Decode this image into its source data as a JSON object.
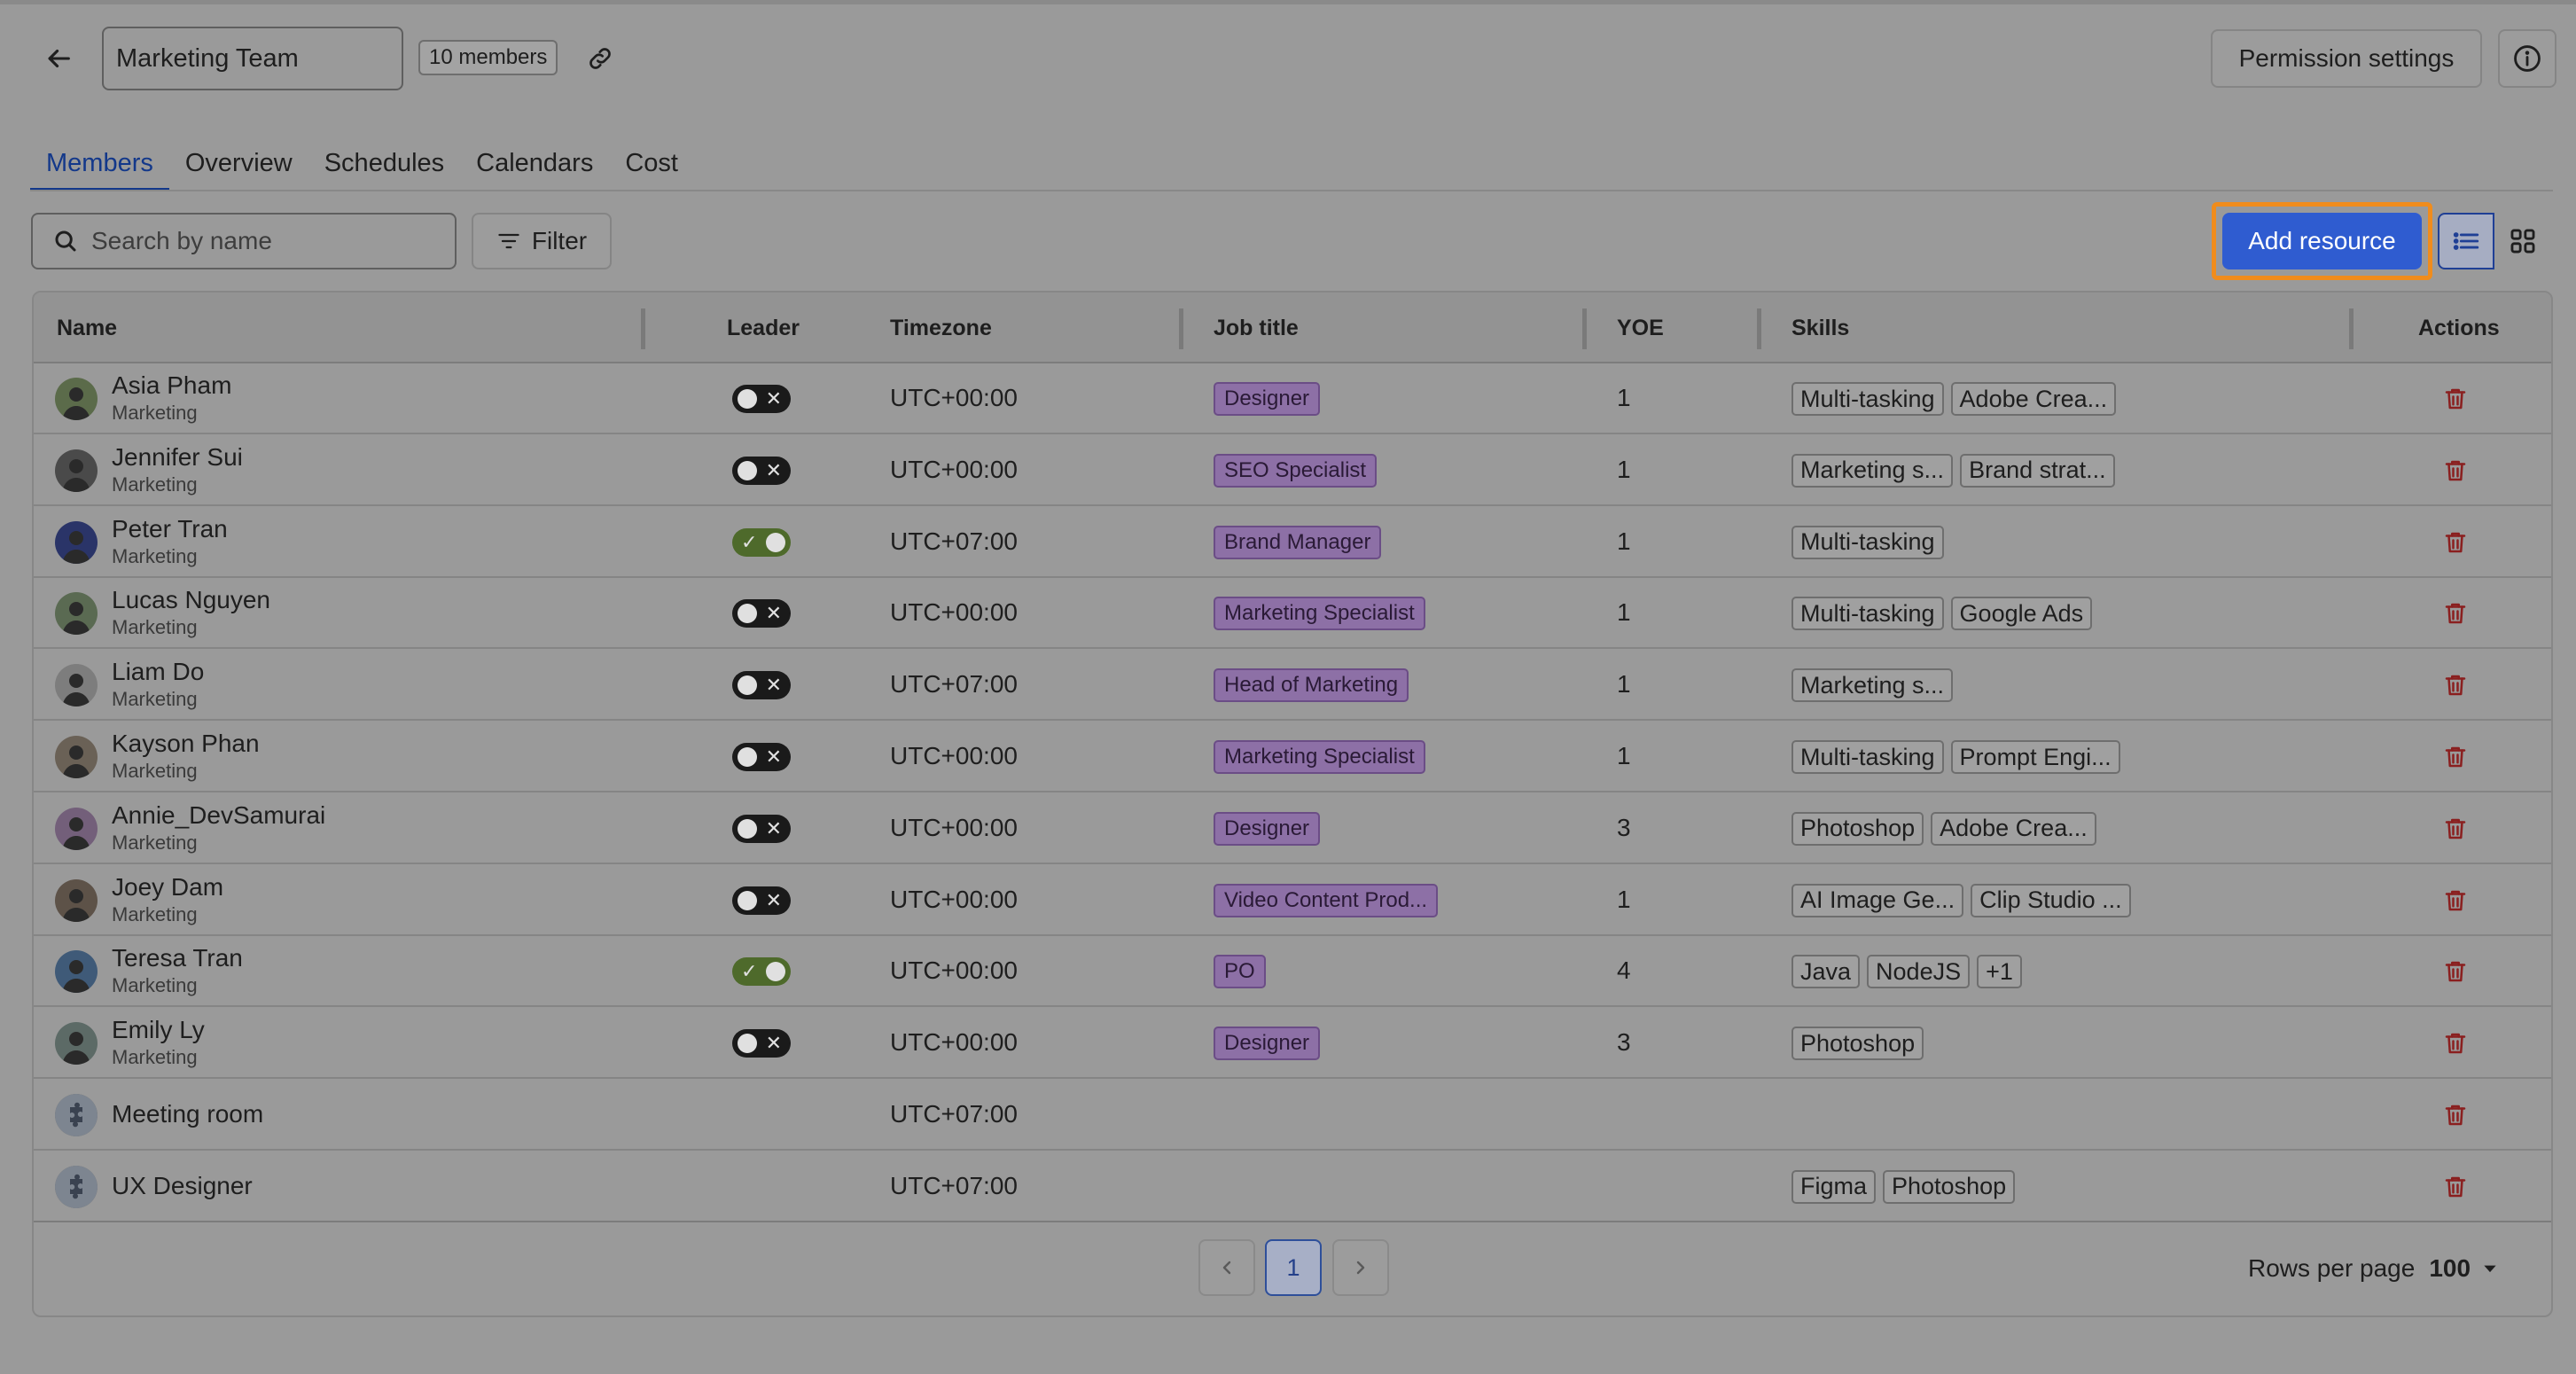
{
  "header": {
    "team_name": "Marketing Team",
    "members_badge": "10 members",
    "permission_label": "Permission settings"
  },
  "tabs": [
    {
      "label": "Members",
      "active": true
    },
    {
      "label": "Overview"
    },
    {
      "label": "Schedules"
    },
    {
      "label": "Calendars"
    },
    {
      "label": "Cost"
    }
  ],
  "toolbar": {
    "search_placeholder": "Search by name",
    "filter_label": "Filter",
    "add_label": "Add resource",
    "view_mode": "list"
  },
  "table": {
    "columns": {
      "name": "Name",
      "leader": "Leader",
      "timezone": "Timezone",
      "job_title": "Job title",
      "yoe": "YOE",
      "skills": "Skills",
      "actions": "Actions"
    },
    "rows": [
      {
        "name": "Asia Pham",
        "team": "Marketing",
        "leader": false,
        "timezone": "UTC+00:00",
        "job": "Designer",
        "yoe": "1",
        "skills": [
          "Multi-tasking",
          "Adobe Crea..."
        ],
        "avatar": "#5b6b4a"
      },
      {
        "name": "Jennifer Sui",
        "team": "Marketing",
        "leader": false,
        "timezone": "UTC+00:00",
        "job": "SEO Specialist",
        "yoe": "1",
        "skills": [
          "Marketing s...",
          "Brand strat..."
        ],
        "avatar": "#4a4a4a"
      },
      {
        "name": "Peter Tran",
        "team": "Marketing",
        "leader": true,
        "timezone": "UTC+07:00",
        "job": "Brand Manager",
        "yoe": "1",
        "skills": [
          "Multi-tasking"
        ],
        "avatar": "#2a3468"
      },
      {
        "name": "Lucas Nguyen",
        "team": "Marketing",
        "leader": false,
        "timezone": "UTC+00:00",
        "job": "Marketing Specialist",
        "yoe": "1",
        "skills": [
          "Multi-tasking",
          "Google Ads"
        ],
        "avatar": "#5a6a52"
      },
      {
        "name": "Liam Do",
        "team": "Marketing",
        "leader": false,
        "timezone": "UTC+07:00",
        "job": "Head of Marketing",
        "yoe": "1",
        "skills": [
          "Marketing s..."
        ],
        "avatar": "#7d7d7d"
      },
      {
        "name": "Kayson Phan",
        "team": "Marketing",
        "leader": false,
        "timezone": "UTC+00:00",
        "job": "Marketing Specialist",
        "yoe": "1",
        "skills": [
          "Multi-tasking",
          "Prompt Engi..."
        ],
        "avatar": "#6a6156"
      },
      {
        "name": "Annie_DevSamurai",
        "team": "Marketing",
        "leader": false,
        "timezone": "UTC+00:00",
        "job": "Designer",
        "yoe": "3",
        "skills": [
          "Photoshop",
          "Adobe Crea..."
        ],
        "avatar": "#735f7a"
      },
      {
        "name": "Joey Dam",
        "team": "Marketing",
        "leader": false,
        "timezone": "UTC+00:00",
        "job": "Video Content Prod...",
        "yoe": "1",
        "skills": [
          "AI Image Ge...",
          "Clip Studio ..."
        ],
        "avatar": "#5d5248"
      },
      {
        "name": "Teresa Tran",
        "team": "Marketing",
        "leader": true,
        "timezone": "UTC+00:00",
        "job": "PO",
        "yoe": "4",
        "skills": [
          "Java",
          "NodeJS",
          "+1"
        ],
        "avatar": "#3f5a78"
      },
      {
        "name": "Emily Ly",
        "team": "Marketing",
        "leader": false,
        "timezone": "UTC+00:00",
        "job": "Designer",
        "yoe": "3",
        "skills": [
          "Photoshop"
        ],
        "avatar": "#5c6a66"
      }
    ],
    "resources": [
      {
        "name": "Meeting room",
        "timezone": "UTC+07:00",
        "skills": []
      },
      {
        "name": "UX Designer",
        "timezone": "UTC+07:00",
        "skills": [
          "Figma",
          "Photoshop"
        ]
      }
    ]
  },
  "pagination": {
    "current_page": "1",
    "rows_per_page_label": "Rows per page",
    "rows_per_page_value": "100"
  },
  "colors": {
    "accent": "#2f5cd0",
    "highlight": "#f08c1c",
    "delete": "#8a1f1f"
  }
}
